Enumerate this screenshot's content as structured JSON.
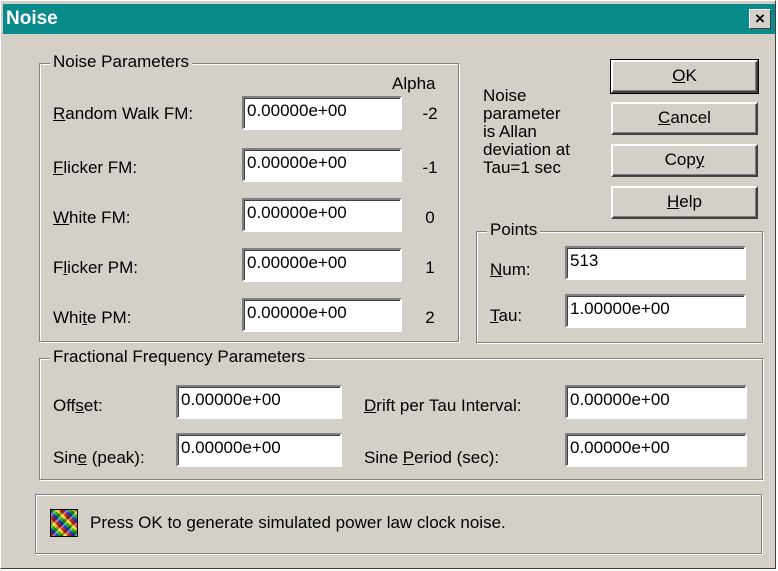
{
  "window": {
    "title": "Noise",
    "close_glyph": "×"
  },
  "noise_params": {
    "legend": "Noise Parameters",
    "alpha_header": "Alpha",
    "rows": [
      {
        "label_first": "R",
        "label_rest": "andom Walk FM:",
        "value": "0.00000e+00",
        "alpha": "-2"
      },
      {
        "label_first": "F",
        "label_rest": "licker FM:",
        "value": "0.00000e+00",
        "alpha": "-1"
      },
      {
        "label_first": "W",
        "label_rest": "hite FM:",
        "value": "0.00000e+00",
        "alpha": "0"
      },
      {
        "label_pre": "F",
        "label_first": "l",
        "label_rest": "icker PM:",
        "value": "0.00000e+00",
        "alpha": "1"
      },
      {
        "label_pre": "Whi",
        "label_first": "t",
        "label_rest": "e PM:",
        "value": "0.00000e+00",
        "alpha": "2"
      }
    ]
  },
  "note": [
    "Noise",
    "parameter",
    "is Allan",
    "deviation at",
    "Tau=1 sec"
  ],
  "buttons": {
    "ok": {
      "u": "O",
      "rest": "K"
    },
    "cancel": {
      "u": "C",
      "rest": "ancel"
    },
    "copy": {
      "pre": "Cop",
      "u": "y",
      "rest": ""
    },
    "help": {
      "u": "H",
      "rest": "elp"
    }
  },
  "points": {
    "legend": "Points",
    "num": {
      "u": "N",
      "rest": "um:",
      "value": "513"
    },
    "tau": {
      "u": "T",
      "rest": "au:",
      "value": "1.00000e+00"
    }
  },
  "freq_params": {
    "legend": "Fractional Frequency Parameters",
    "offset": {
      "pre": "Off",
      "u": "s",
      "rest": "et:",
      "value": "0.00000e+00"
    },
    "sine": {
      "pre": "Sin",
      "u": "e",
      "rest": " (peak):",
      "value": "0.00000e+00"
    },
    "drift": {
      "pre": "",
      "u": "D",
      "rest": "rift per Tau Interval:",
      "value": "0.00000e+00"
    },
    "period": {
      "pre": "Sine ",
      "u": "P",
      "rest": "eriod (sec):",
      "value": "0.00000e+00"
    }
  },
  "status": {
    "text": "Press OK to generate simulated power law clock noise.",
    "icon": "noise-pattern-icon"
  }
}
